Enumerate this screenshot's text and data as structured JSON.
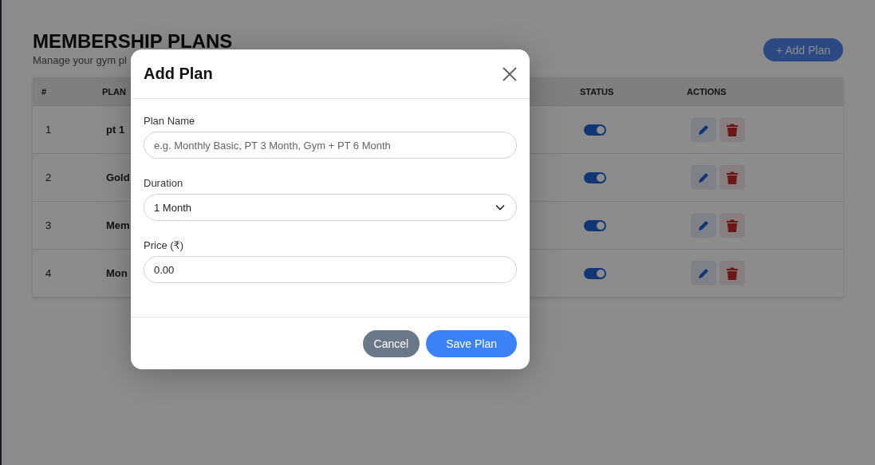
{
  "page": {
    "title": "MEMBERSHIP PLANS",
    "subtitle": "Manage your gym pl",
    "add_button": "+ Add Plan"
  },
  "table": {
    "columns": [
      "#",
      "PLAN",
      "STATUS",
      "ACTIONS"
    ],
    "rows": [
      {
        "number": "1",
        "name": "pt 1",
        "active": true
      },
      {
        "number": "2",
        "name": "Gold",
        "active": true
      },
      {
        "number": "3",
        "name": "Mem",
        "active": true
      },
      {
        "number": "4",
        "name": "Mon",
        "active": true
      }
    ]
  },
  "modal": {
    "title": "Add Plan",
    "fields": [
      {
        "kind": "text",
        "label": "Plan Name",
        "placeholder": "e.g. Monthly Basic, PT 3 Month, Gym + PT 6 Month"
      },
      {
        "kind": "select",
        "label": "Duration",
        "value": "1 Month"
      },
      {
        "kind": "text",
        "label": "Price (₹)",
        "value": "0.00"
      }
    ],
    "buttons": [
      {
        "kind": "secondary",
        "label": "Cancel"
      },
      {
        "kind": "primary",
        "label": "Save Plan"
      }
    ]
  }
}
